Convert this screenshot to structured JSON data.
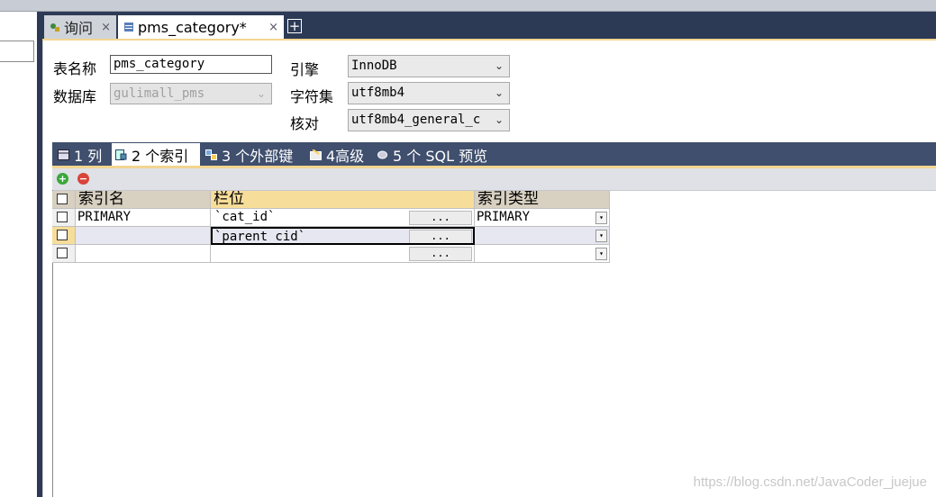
{
  "tabs": [
    {
      "label": "询问",
      "close": "×"
    },
    {
      "label": "pms_category*",
      "close": "×"
    }
  ],
  "tab_add": "+",
  "form": {
    "table_name_label": "表名称",
    "table_name_value": "pms_category",
    "database_label": "数据库",
    "database_value": "gulimall_pms",
    "engine_label": "引擎",
    "engine_value": "InnoDB",
    "charset_label": "字符集",
    "charset_value": "utf8mb4",
    "collation_label": "核对",
    "collation_value": "utf8mb4_general_c"
  },
  "subtabs": [
    {
      "label": "1 列",
      "active": false
    },
    {
      "label": "2 个索引",
      "active": true
    },
    {
      "label": "3 个外部键",
      "active": false
    },
    {
      "label": "4高级",
      "active": false
    },
    {
      "label": "5 个 SQL 预览",
      "active": false
    }
  ],
  "grid": {
    "headers": [
      "索引名",
      "栏位",
      "索引类型"
    ],
    "rows": [
      {
        "name": "PRIMARY",
        "columns": "`cat_id`",
        "type": "PRIMARY"
      },
      {
        "name": "",
        "columns": "`parent_cid`",
        "type": ""
      },
      {
        "name": "",
        "columns": "",
        "type": ""
      }
    ],
    "ellipsis": "...",
    "dropdown": "▾"
  },
  "watermark": "https://blog.csdn.net/JavaCoder_juejue"
}
